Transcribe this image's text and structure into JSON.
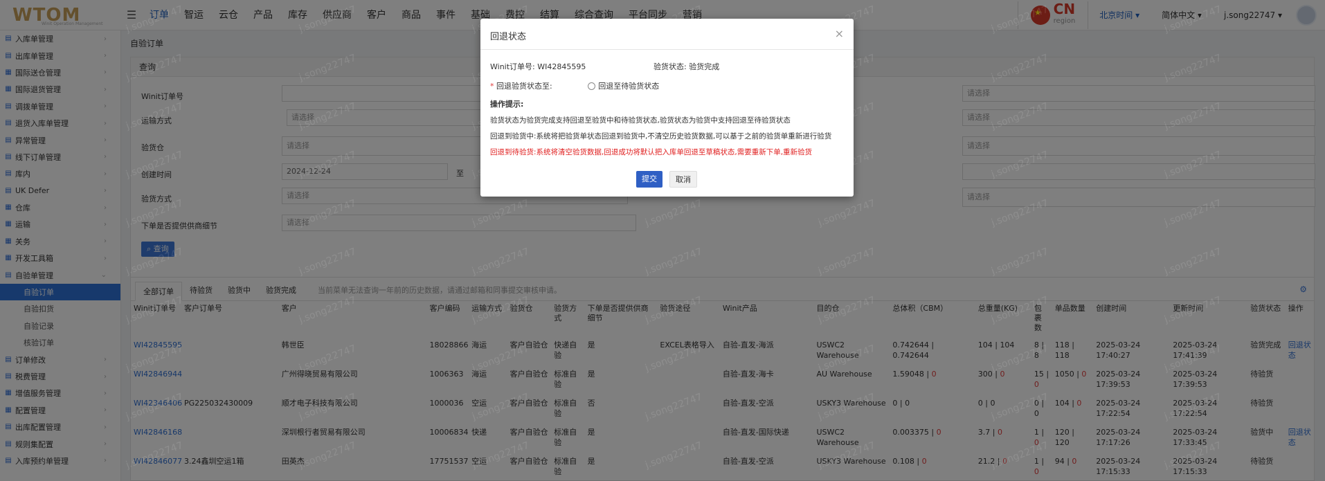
{
  "header": {
    "logo": "WTOM",
    "logo_sub": "Winit Operation Management",
    "nav": [
      "订单",
      "智运",
      "云仓",
      "产品",
      "库存",
      "供应商",
      "客户",
      "商品",
      "事件",
      "基础",
      "费控",
      "结算",
      "综合查询",
      "平台同步",
      "营销"
    ],
    "region_code": "CN",
    "region_word": "region",
    "timezone": "北京时间",
    "language": "简体中文",
    "user": "j.song22747"
  },
  "sidebar": {
    "items": [
      "入库单管理",
      "出库单管理",
      "国际送仓管理",
      "国际退货管理",
      "调拨单管理",
      "退货入库单管理",
      "异常管理",
      "线下订单管理",
      "库内",
      "UK Defer",
      "仓库",
      "运输",
      "关务",
      "开发工具箱",
      "自验单管理"
    ],
    "sub_items": [
      "自验订单",
      "自验扣货",
      "自验记录",
      "核验订单"
    ],
    "items_after": [
      "订单修改",
      "税费管理",
      "增值服务管理",
      "配置管理",
      "出库配置管理",
      "规则集配置",
      "入库预约单管理"
    ]
  },
  "main": {
    "breadcrumb": "自验订单",
    "query_title": "查询",
    "labels": {
      "order_no": "Winit订单号",
      "transport": "运输方式",
      "warehouse": "验货仓",
      "created": "创建时间",
      "inspect_way": "验货方式",
      "supplier": "下单是否提供供商细节"
    },
    "placeholder": "请选择",
    "date_start": "2024-12-24",
    "date_to": "至",
    "query_button": "查询",
    "tabs": [
      "全部订单",
      "待验货",
      "验货中",
      "验货完成"
    ],
    "tab_note": "当前菜单无法查询一年前的历史数据，请通过邮箱和同事提交审核申请。",
    "columns": [
      "Winit订单号",
      "客户订单号",
      "客户",
      "客户编码",
      "运输方式",
      "验货仓",
      "验货方式",
      "下单是否提供供商细节",
      "验货途径",
      "Winit产品",
      "目的仓",
      "总体积（CBM）",
      "总重量(KG)",
      "包裹数",
      "单品数量",
      "创建时间",
      "更新时间",
      "验货状态",
      "操作"
    ],
    "rows": [
      {
        "no": "WI42845595",
        "cust_no": "",
        "cust": "韩世臣",
        "code": "18028866",
        "transport": "海运",
        "wh": "客户自验仓",
        "way": "快递自验",
        "sup": "是",
        "path": "EXCEL表格导入",
        "product": "自验-直发-海派",
        "dest": "USWC2 Warehouse",
        "vol": "0.742644 | 0.742644",
        "wt": "104 | 104",
        "pkg": "8 | 8",
        "qty": "118 | 118",
        "created": "2025-03-24 17:40:27",
        "updated": "2025-03-24 17:41:39",
        "status": "验货完成",
        "op": "回退状态"
      },
      {
        "no": "WI42846944",
        "cust_no": "",
        "cust": "广州得晓贸易有限公司",
        "code": "1006363",
        "transport": "海运",
        "wh": "客户自验仓",
        "way": "标准自验",
        "sup": "是",
        "path": "",
        "product": "自验-直发-海卡",
        "dest": "AU Warehouse",
        "vol": "1.59048 | 0",
        "wt": "300 | 0",
        "pkg": "15 | 0",
        "qty": "1050 | 0",
        "created": "2025-03-24 17:39:53",
        "updated": "2025-03-24 17:39:53",
        "status": "待验货",
        "op": ""
      },
      {
        "no": "WI42346406",
        "cust_no": "PG225032430009",
        "cust": "顺才电子科技有限公司",
        "code": "1000036",
        "transport": "空运",
        "wh": "客户自验仓",
        "way": "标准自验",
        "sup": "否",
        "path": "",
        "product": "自验-直发-空派",
        "dest": "USKY3 Warehouse",
        "vol": "0 | 0",
        "wt": "0 | 0",
        "pkg": "0 | 0",
        "qty": "104 | 0",
        "created": "2025-03-24 17:22:54",
        "updated": "2025-03-24 17:22:54",
        "status": "待验货",
        "op": ""
      },
      {
        "no": "WI42846168",
        "cust_no": "",
        "cust": "深圳根行者贸易有限公司",
        "code": "10006834",
        "transport": "快递",
        "wh": "客户自验仓",
        "way": "标准自验",
        "sup": "是",
        "path": "",
        "product": "自验-直发-国际快递",
        "dest": "USWC2 Warehouse",
        "vol": "0.003375 | 0",
        "wt": "3.7 | 0",
        "pkg": "1 | 0",
        "qty": "120 | 120",
        "created": "2025-03-24 17:17:26",
        "updated": "2025-03-24 17:33:45",
        "status": "验货中",
        "op": "回退状态"
      },
      {
        "no": "WI42846077",
        "cust_no": "3.24鑫圳空运1箱",
        "cust": "田英杰",
        "code": "17751537",
        "transport": "空运",
        "wh": "客户自验仓",
        "way": "标准自验",
        "sup": "是",
        "path": "",
        "product": "自验-直发-空派",
        "dest": "USKY3 Warehouse",
        "vol": "0.108 | 0",
        "wt": "21.2 | 0",
        "pkg": "1 | 0",
        "qty": "94 | 0",
        "created": "2025-03-24 17:15:33",
        "updated": "2025-03-24 17:15:33",
        "status": "待验货",
        "op": ""
      }
    ]
  },
  "modal": {
    "title": "回退状态",
    "close": "×",
    "order_label": "Winit订单号:",
    "order_value": "WI42845595",
    "status_label": "验货状态:",
    "status_value": "验货完成",
    "req_mark": "*",
    "rollback_label": "回退验货状态至:",
    "radio_label": "回退至待验货状态",
    "tip_title": "操作提示:",
    "tip1": "验货状态为验货完成支持回退至验货中和待验货状态,验货状态为验货中支持回退至待验货状态",
    "tip2": "回退到验货中:系统将把验货单状态回退到验货中,不清空历史验货数据,可以基于之前的验货单重新进行验货",
    "tip3": "回退到待验货:系统将清空验货数据,回退成功将默认把入库单回退至草稿状态,需要重新下单,重新验货",
    "submit": "提交",
    "cancel": "取消"
  },
  "watermark": "j.song22747"
}
